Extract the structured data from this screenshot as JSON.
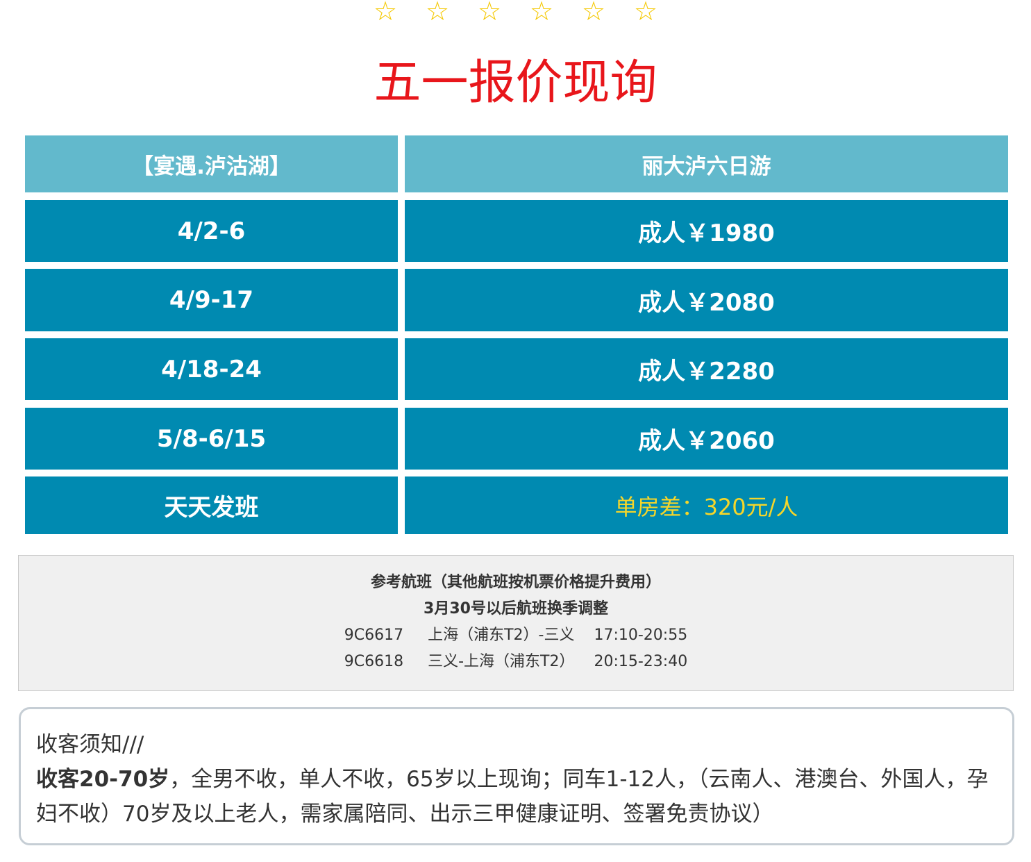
{
  "stars": [
    "☆",
    "☆",
    "☆",
    "☆",
    "☆",
    "☆"
  ],
  "title": "五一报价现询",
  "table": {
    "header": {
      "left": "【宴遇.泸沽湖】",
      "right": "丽大泸六日游"
    },
    "rows": [
      {
        "left": "4/2-6",
        "right": "成人￥1980"
      },
      {
        "left": "4/9-17",
        "right": "成人￥2080"
      },
      {
        "left": "4/18-24",
        "right": "成人￥2280"
      },
      {
        "left": "5/8-6/15",
        "right": "成人￥2060"
      },
      {
        "left": "天天发班",
        "right": "单房差：320元/人"
      }
    ]
  },
  "flights": {
    "heading1": "参考航班（其他航班按机票价格提升费用）",
    "heading2": "3月30号以后航班换季调整",
    "lines": [
      "9C6617     上海（浦东T2）-三义    17:10-20:55",
      "9C6618     三义-上海（浦东T2）    20:15-23:40"
    ]
  },
  "notice": {
    "title": "收客须知///",
    "bold": "收客20-70岁",
    "text": "，全男不收，单人不收，65岁以上现询；同车1-12人，（云南人、港澳台、外国人，孕妇不收）70岁及以上老人，需家属陪同、出示三甲健康证明、签署免责协议）"
  },
  "colors": {
    "header_cell": "#62b9cc",
    "body_cell": "#008ab1",
    "title": "#e8161b",
    "star": "#f5c800",
    "note": "#f6d629"
  }
}
